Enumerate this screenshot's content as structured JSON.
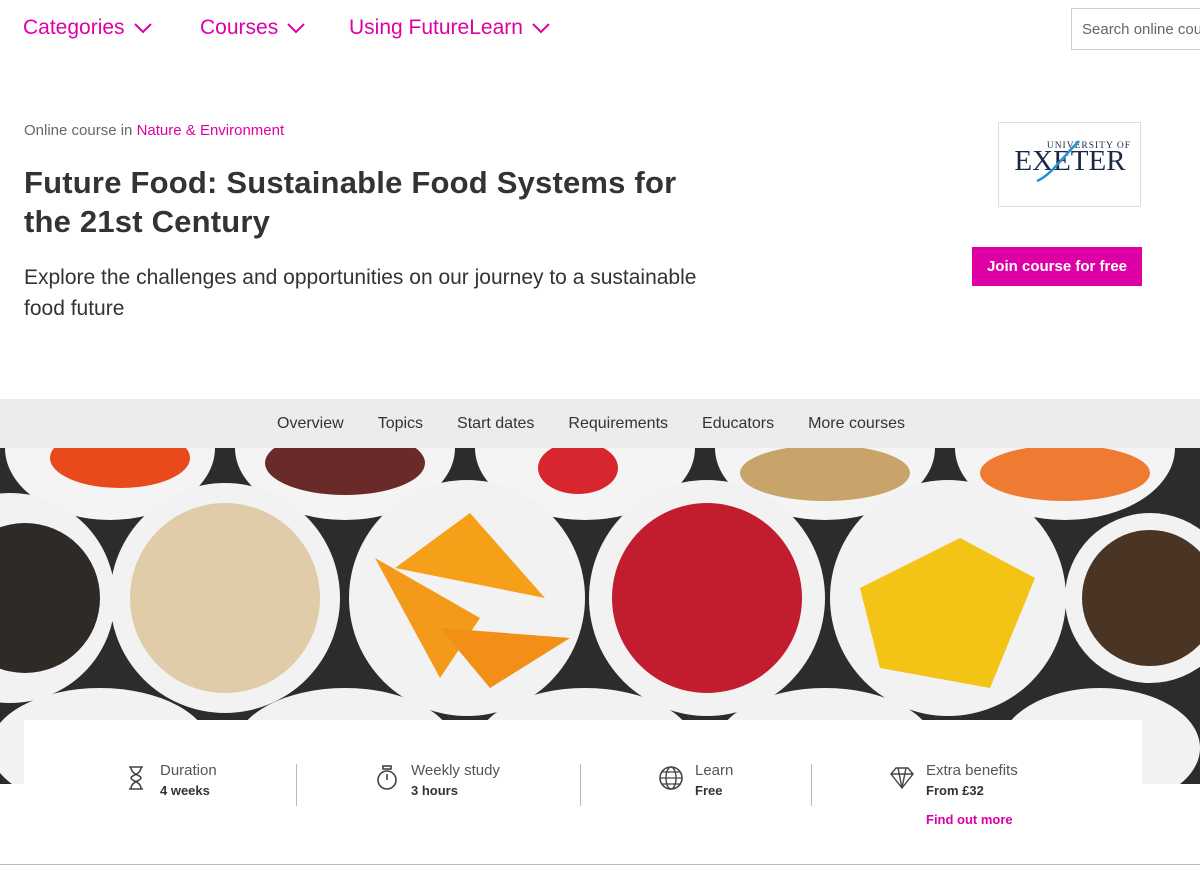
{
  "nav": {
    "items": [
      {
        "label": "Categories"
      },
      {
        "label": "Courses"
      },
      {
        "label": "Using FutureLearn"
      }
    ],
    "search_placeholder": "Search online courses",
    "accent": "#de00a5"
  },
  "course": {
    "crumb_prefix": "Online course in",
    "crumb_link": "Nature & Environment",
    "title": "Future Food: Sustainable Food Systems for the 21st Century",
    "subtitle": "Explore the challenges and opportunities on our journey to a sustainable food future",
    "provider_logo_top": "UNIVERSITY OF",
    "provider_logo_main": "EXETER",
    "join_label": "Join course for free"
  },
  "subnav": {
    "items": [
      {
        "label": "Overview"
      },
      {
        "label": "Topics"
      },
      {
        "label": "Start dates"
      },
      {
        "label": "Requirements"
      },
      {
        "label": "Educators"
      },
      {
        "label": "More courses"
      }
    ]
  },
  "info": {
    "items": [
      {
        "icon": "hourglass-icon",
        "label": "Duration",
        "value": "4 weeks"
      },
      {
        "icon": "stopwatch-icon",
        "label": "Weekly study",
        "value": "3 hours"
      },
      {
        "icon": "globe-icon",
        "label": "Learn",
        "value": "Free"
      },
      {
        "icon": "diamond-icon",
        "label": "Extra benefits",
        "value": "From £32",
        "link": "Find out more"
      }
    ]
  }
}
